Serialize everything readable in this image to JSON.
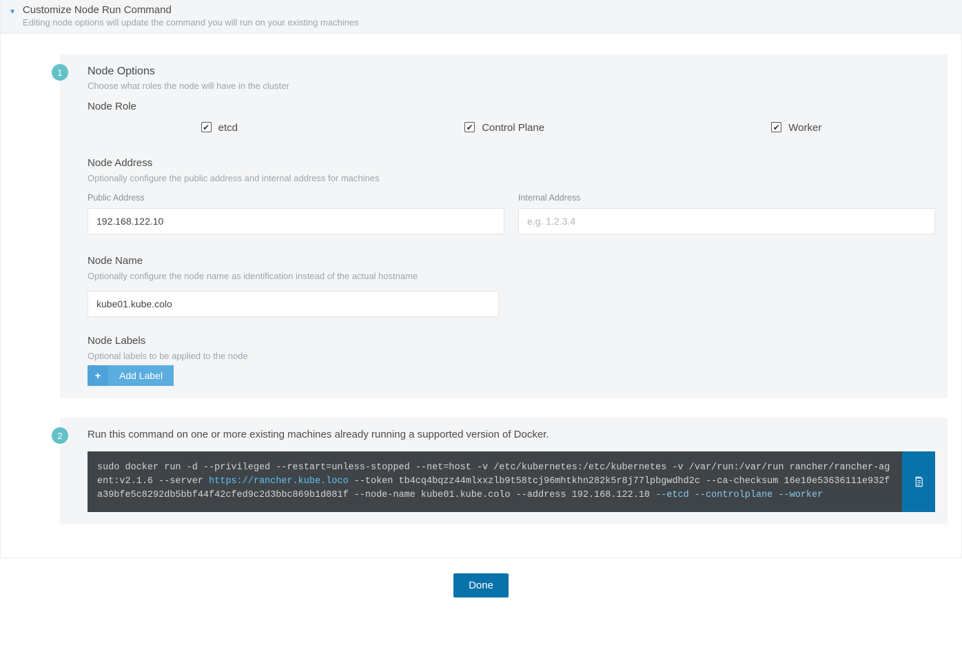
{
  "header": {
    "title": "Customize Node Run Command",
    "subtitle": "Editing node options will update the command you will run on your existing machines"
  },
  "step1": {
    "badge": "1",
    "title": "Node Options",
    "help": "Choose what roles the node will have in the cluster",
    "nodeRole": {
      "title": "Node Role",
      "options": {
        "etcd": "etcd",
        "controlPlane": "Control Plane",
        "worker": "Worker"
      }
    },
    "nodeAddress": {
      "title": "Node Address",
      "help": "Optionally configure the public address and internal address for machines",
      "publicLabel": "Public Address",
      "publicValue": "192.168.122.10",
      "internalLabel": "Internal Address",
      "internalPlaceholder": "e.g. 1.2.3.4"
    },
    "nodeName": {
      "title": "Node Name",
      "help": "Optionally configure the node name as identification instead of the actual hostname",
      "value": "kube01.kube.colo"
    },
    "nodeLabels": {
      "title": "Node Labels",
      "help": "Optional labels to be applied to the node",
      "addButton": "Add Label"
    }
  },
  "step2": {
    "badge": "2",
    "instruction": "Run this command on one or more existing machines already running a supported version of Docker.",
    "command": {
      "prefix": "sudo docker run -d --privileged --restart=unless-stopped --net=host -v /etc/kubernetes:/etc/kubernetes -v /var/run:/var/run rancher/rancher-agent:v2.1.6 --server ",
      "server": "https://rancher.kube.loco",
      "mid": " --token tb4cq4bqzz44mlxxzlb9t58tcj96mhtkhn282k5r8j77lpbgwdhd2c --ca-checksum 16e10e53636111e932fa39bfe5c8292db5bbf44f42cfed9c2d3bbc869b1d081f --node-name kube01.kube.colo --address 192.168.122.10 ",
      "flags": "--etcd --controlplane --worker"
    }
  },
  "footer": {
    "done": "Done"
  }
}
